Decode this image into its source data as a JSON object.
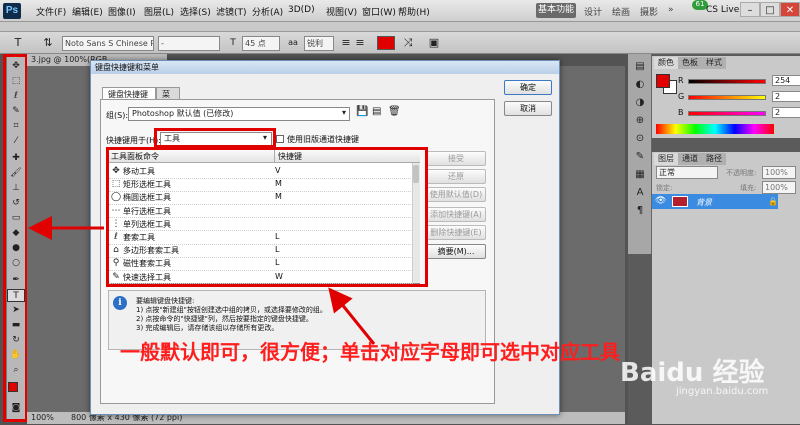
{
  "app": {
    "logo": "Ps",
    "menus": [
      "文件(F)",
      "编辑(E)",
      "图像(I)",
      "图层(L)",
      "选择(S)",
      "滤镜(T)",
      "分析(A)",
      "3D(D)",
      "视图(V)",
      "窗口(W)",
      "帮助(H)"
    ],
    "workspace_active": "基本功能",
    "workspaces": [
      "设计",
      "绘画",
      "摄影"
    ],
    "expand": "»",
    "cs_live_badge": "61",
    "cs_live": "CS Live",
    "window_controls": [
      "–",
      "□",
      "✕"
    ]
  },
  "options_bar": {
    "font_family": "Noto Sans S Chinese R...",
    "font_style": "-",
    "font_size": "45 点",
    "anti_alias": "锐利",
    "text_color": "#e00000"
  },
  "document": {
    "tab_title": "3.jpg @ 100%(RGB",
    "zoom": "100%",
    "status": "800 像素 x 430 像素 (72 ppi)"
  },
  "color_panel": {
    "tabs": [
      "颜色",
      "色板",
      "样式"
    ],
    "channels": [
      {
        "label": "R",
        "value": "254"
      },
      {
        "label": "G",
        "value": "2"
      },
      {
        "label": "B",
        "value": "2"
      }
    ]
  },
  "layers_panel": {
    "tabs": [
      "图层",
      "通道",
      "路径"
    ],
    "blend_mode": "正常",
    "opacity_label": "不透明度:",
    "opacity": "100%",
    "lock_label": "锁定:",
    "fill_label": "填充:",
    "fill": "100%",
    "layer_name": "背景"
  },
  "dialog": {
    "title": "键盘快捷键和菜单",
    "tabs": [
      "键盘快捷键",
      "菜单"
    ],
    "set_label": "组(S):",
    "set_value": "Photoshop 默认值 (已修改)",
    "shortcuts_for_label": "快捷键用于(H):",
    "shortcuts_for_value": "工具",
    "legacy_checkbox": "使用旧版通道快捷键",
    "col_command": "工具面板命令",
    "col_shortcut": "快捷键",
    "rows": [
      {
        "icon": "move-icon",
        "glyph": "✥",
        "name": "移动工具",
        "key": "V"
      },
      {
        "icon": "rect-marquee-icon",
        "glyph": "⬚",
        "name": "矩形选框工具",
        "key": "M"
      },
      {
        "icon": "ellipse-marquee-icon",
        "glyph": "◯",
        "name": "椭圆选框工具",
        "key": "M"
      },
      {
        "icon": "row-marquee-icon",
        "glyph": "⋯",
        "name": "单行选框工具",
        "key": ""
      },
      {
        "icon": "column-marquee-icon",
        "glyph": "⋮",
        "name": "单列选框工具",
        "key": ""
      },
      {
        "icon": "lasso-icon",
        "glyph": "ℓ",
        "name": "套索工具",
        "key": "L"
      },
      {
        "icon": "polygon-lasso-icon",
        "glyph": "⌂",
        "name": "多边形套索工具",
        "key": "L"
      },
      {
        "icon": "magnetic-lasso-icon",
        "glyph": "⚲",
        "name": "磁性套索工具",
        "key": "L"
      },
      {
        "icon": "quick-select-icon",
        "glyph": "✎",
        "name": "快速选择工具",
        "key": "W"
      }
    ],
    "buttons": {
      "ok": "确定",
      "cancel": "取消",
      "accept": "接受",
      "undo": "还原",
      "use_default": "使用默认值(D)",
      "add_shortcut": "添加快捷键(A)",
      "delete_shortcut": "删除快捷键(E)",
      "summarize": "摘要(M)..."
    },
    "info": [
      "要编辑键盘快捷键:",
      "1) 点按\"新建组\"按钮创建选中组的拷贝，或选择要修改的组。",
      "2) 点按命令的\"快捷键\"列，然后按要指定的键盘快捷键。",
      "3) 完成编辑后，请存储该组以存储所有更改。"
    ]
  },
  "annotation": {
    "text": "一般默认即可，很方便；单击对应字母即可选中对应工具",
    "color": "#e00000"
  },
  "watermark": {
    "logo": "Baidu 经验",
    "url": "jingyan.baidu.com"
  }
}
